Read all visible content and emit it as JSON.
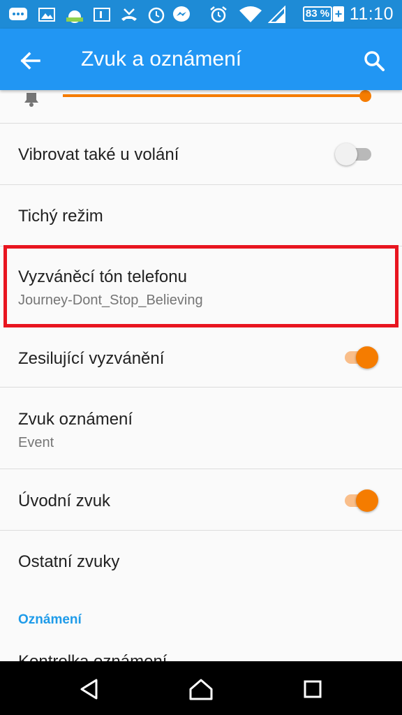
{
  "status_bar": {
    "time": "11:10",
    "battery_percent": "83 %",
    "battery_plus": "+",
    "icons": [
      "messaging-icon",
      "gallery-icon",
      "weather-icon",
      "info-card-icon",
      "missed-call-icon",
      "alarm-clock-app-icon",
      "messenger-icon",
      "alarm-icon",
      "wifi-icon",
      "signal-icon",
      "battery-icon"
    ]
  },
  "app_bar": {
    "title": "Zvuk a oznámení"
  },
  "settings": {
    "vibrate": {
      "title": "Vibrovat také u volání",
      "enabled": false
    },
    "silent": {
      "title": "Tichý režim"
    },
    "ringtone": {
      "title": "Vyzváněcí tón telefonu",
      "value": "Journey-Dont_Stop_Believing"
    },
    "ascending": {
      "title": "Zesilující vyzvánění",
      "enabled": true
    },
    "notification_sound": {
      "title": "Zvuk oznámení",
      "value": "Event"
    },
    "startup_sound": {
      "title": "Úvodní zvuk",
      "enabled": true
    },
    "other_sounds": {
      "title": "Ostatní zvuky"
    }
  },
  "section": {
    "notifications_header": "Oznámení",
    "partial_item": "Kontrolka oznámení"
  },
  "volume": {
    "level": 1.0
  },
  "colors": {
    "status_bar": "#1e8bd6",
    "app_bar": "#2196f3",
    "accent": "#f57c00",
    "highlight": "#e8151f",
    "section_header": "#1e9be9"
  }
}
